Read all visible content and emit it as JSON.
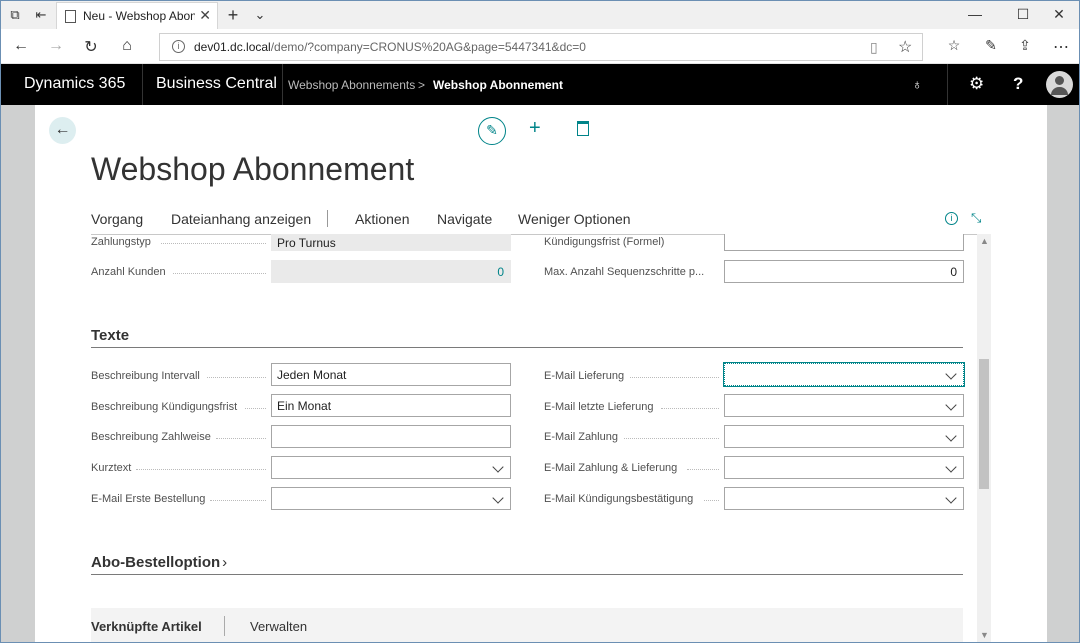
{
  "browser": {
    "tab_title": "Neu - Webshop Abonne",
    "url_host": "dev01.dc.local",
    "url_path": "/demo/?company=CRONUS%20AG&page=5447341&dc=0"
  },
  "header": {
    "brand": "Dynamics 365",
    "app": "Business Central",
    "breadcrumb_parent": "Webshop Abonnements",
    "breadcrumb_sep": ">",
    "breadcrumb_current": "Webshop Abonnement",
    "help": "?"
  },
  "page": {
    "title": "Webshop Abonnement",
    "actions": [
      "Vorgang",
      "Dateianhang anzeigen",
      "Aktionen",
      "Navigate",
      "Weniger Optionen"
    ]
  },
  "general": {
    "zahlungstyp_label": "Zahlungstyp",
    "zahlungstyp_value": "Pro Turnus",
    "anzahl_kunden_label": "Anzahl Kunden",
    "anzahl_kunden_value": "0",
    "kuendigungsfrist_label": "Kündigungsfrist (Formel)",
    "kuendigungsfrist_value": "",
    "max_seq_label": "Max. Anzahl Sequenzschritte p...",
    "max_seq_value": "0"
  },
  "texte": {
    "heading": "Texte",
    "left": [
      {
        "label": "Beschreibung Intervall",
        "value": "Jeden Monat"
      },
      {
        "label": "Beschreibung Kündigungsfrist",
        "value": "Ein Monat"
      },
      {
        "label": "Beschreibung Zahlweise",
        "value": ""
      },
      {
        "label": "Kurztext",
        "value": ""
      },
      {
        "label": "E-Mail Erste Bestellung",
        "value": ""
      }
    ],
    "right": [
      {
        "label": "E-Mail Lieferung",
        "value": ""
      },
      {
        "label": "E-Mail letzte Lieferung",
        "value": ""
      },
      {
        "label": "E-Mail Zahlung",
        "value": ""
      },
      {
        "label": "E-Mail Zahlung & Lieferung",
        "value": ""
      },
      {
        "label": "E-Mail Kündigungsbestätigung",
        "value": ""
      }
    ]
  },
  "abo": {
    "heading": "Abo-Bestelloption",
    "chevron": "›"
  },
  "subpage": {
    "title": "Verknüpfte Artikel",
    "action": "Verwalten"
  },
  "colors": {
    "accent": "#008489",
    "header_bg": "#000000"
  }
}
